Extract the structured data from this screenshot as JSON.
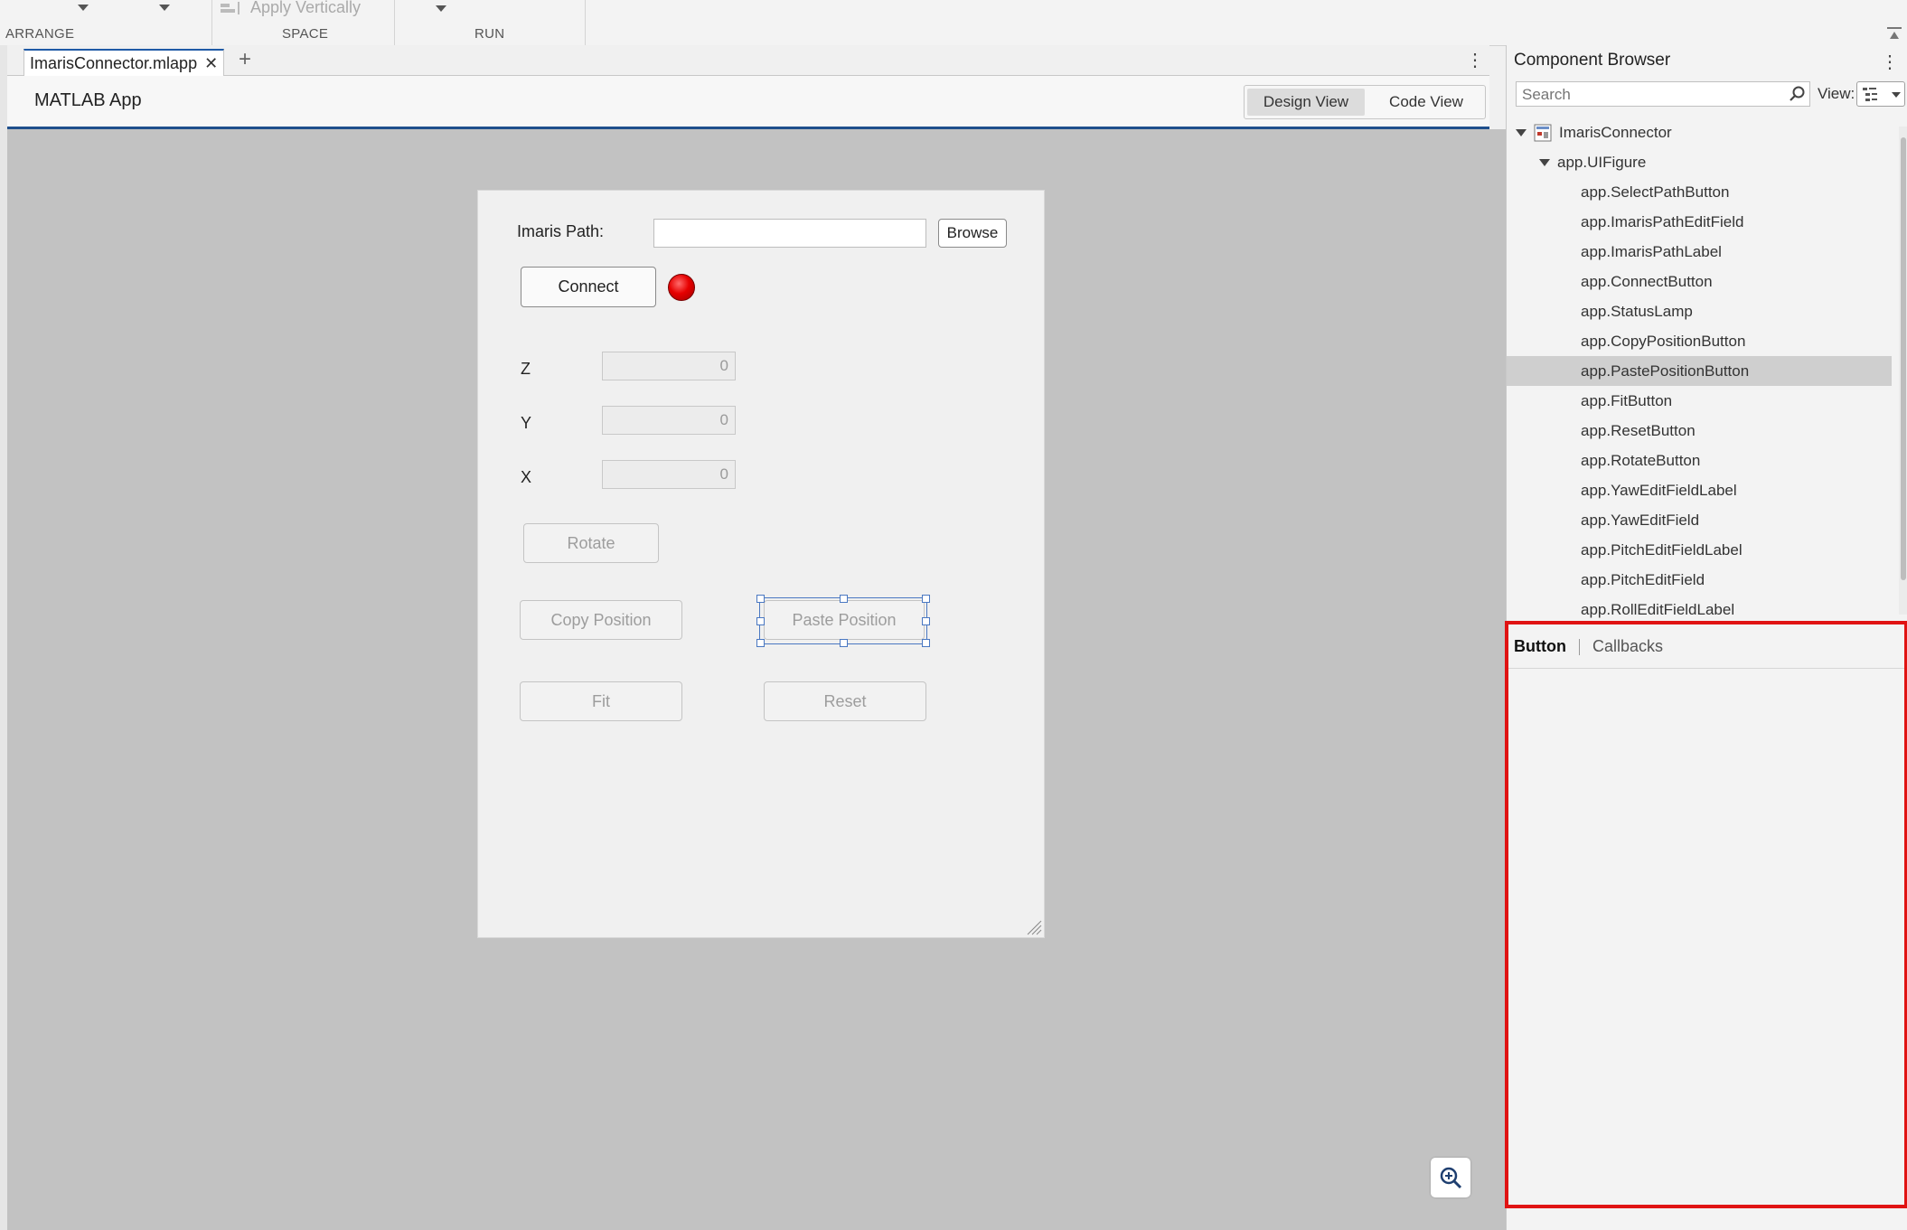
{
  "toolstrip": {
    "sections": [
      {
        "label": "ARRANGE"
      },
      {
        "label": "SPACE"
      },
      {
        "label": "RUN"
      }
    ],
    "apply_vertically_label": "Apply Vertically"
  },
  "document_tab": {
    "label": "ImarisConnector.mlapp"
  },
  "app_header": {
    "title": "MATLAB App",
    "design_view_label": "Design View",
    "code_view_label": "Code View"
  },
  "figure": {
    "imaris_path_label": "Imaris Path:",
    "imaris_path_value": "",
    "browse_label": "Browse",
    "connect_label": "Connect",
    "status_lamp_color": "#e60000",
    "z_label": "Z",
    "z_value": "0",
    "y_label": "Y",
    "y_value": "0",
    "x_label": "X",
    "x_value": "0",
    "rotate_label": "Rotate",
    "copy_position_label": "Copy Position",
    "paste_position_label": "Paste Position",
    "fit_label": "Fit",
    "reset_label": "Reset"
  },
  "component_browser": {
    "title": "Component Browser",
    "search_placeholder": "Search",
    "view_label": "View:",
    "tree": [
      {
        "label": "ImarisConnector"
      },
      {
        "label": "app.UIFigure"
      },
      {
        "label": "app.SelectPathButton"
      },
      {
        "label": "app.ImarisPathEditField"
      },
      {
        "label": "app.ImarisPathLabel"
      },
      {
        "label": "app.ConnectButton"
      },
      {
        "label": "app.StatusLamp"
      },
      {
        "label": "app.CopyPositionButton"
      },
      {
        "label": "app.PastePositionButton",
        "selected": true
      },
      {
        "label": "app.FitButton"
      },
      {
        "label": "app.ResetButton"
      },
      {
        "label": "app.RotateButton"
      },
      {
        "label": "app.YawEditFieldLabel"
      },
      {
        "label": "app.YawEditField"
      },
      {
        "label": "app.PitchEditFieldLabel"
      },
      {
        "label": "app.PitchEditField"
      },
      {
        "label": "app.RollEditFieldLabel"
      }
    ]
  },
  "inspector": {
    "tab_button": "Button",
    "tab_callbacks": "Callbacks",
    "highlight_color": "#e01313"
  },
  "colors": {
    "accent": "#1f4f8c",
    "selection": "#4a78c2",
    "canvas": "#c2c2c2"
  }
}
